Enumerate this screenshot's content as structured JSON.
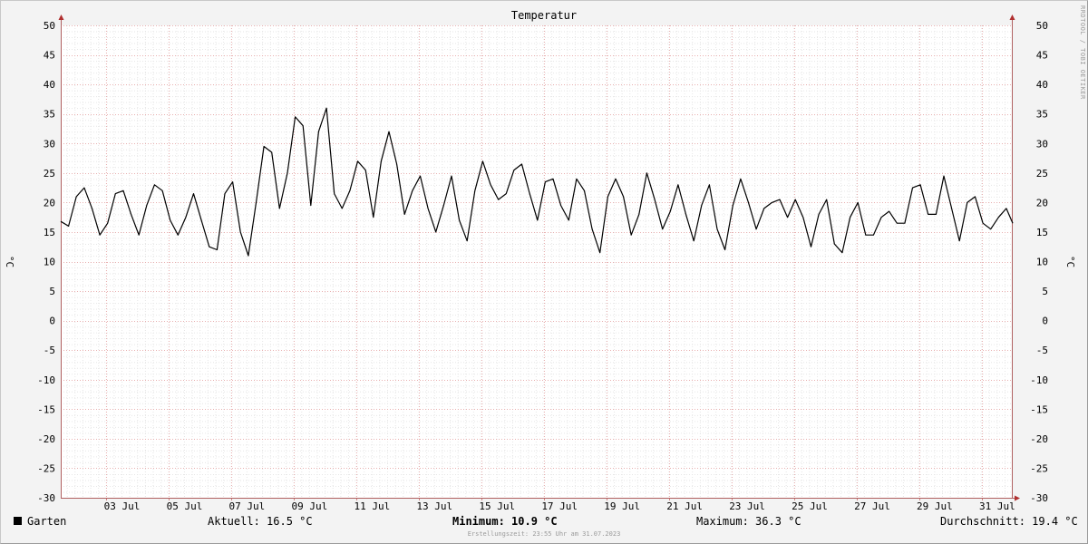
{
  "chart_data": {
    "type": "line",
    "title": "Temperatur",
    "ylabel": "°C",
    "ylim": [
      -30,
      50
    ],
    "xlim": [
      "2023-07-01 13:00",
      "2023-07-31 23:55"
    ],
    "y_ticks": [
      50,
      45,
      40,
      35,
      30,
      25,
      20,
      15,
      10,
      5,
      0,
      -5,
      -10,
      -15,
      -20,
      -25,
      -30
    ],
    "x_tick_labels": [
      "03 Jul",
      "05 Jul",
      "07 Jul",
      "09 Jul",
      "11 Jul",
      "13 Jul",
      "15 Jul",
      "17 Jul",
      "19 Jul",
      "21 Jul",
      "23 Jul",
      "25 Jul",
      "27 Jul",
      "29 Jul",
      "31 Jul"
    ],
    "grid": true,
    "line_color": "#000000",
    "series": [
      {
        "name": "Garten",
        "x": [
          "2023-07-01 13:00",
          "2023-07-01 19:00",
          "2023-07-02 01:00",
          "2023-07-02 07:00",
          "2023-07-02 13:00",
          "2023-07-02 19:00",
          "2023-07-03 01:00",
          "2023-07-03 07:00",
          "2023-07-03 13:00",
          "2023-07-03 19:00",
          "2023-07-04 01:00",
          "2023-07-04 07:00",
          "2023-07-04 13:00",
          "2023-07-04 19:00",
          "2023-07-05 01:00",
          "2023-07-05 07:00",
          "2023-07-05 13:00",
          "2023-07-05 19:00",
          "2023-07-06 01:00",
          "2023-07-06 07:00",
          "2023-07-06 13:00",
          "2023-07-06 19:00",
          "2023-07-07 01:00",
          "2023-07-07 07:00",
          "2023-07-07 13:00",
          "2023-07-07 19:00",
          "2023-07-08 01:00",
          "2023-07-08 07:00",
          "2023-07-08 13:00",
          "2023-07-08 19:00",
          "2023-07-09 01:00",
          "2023-07-09 07:00",
          "2023-07-09 13:00",
          "2023-07-09 19:00",
          "2023-07-10 01:00",
          "2023-07-10 07:00",
          "2023-07-10 13:00",
          "2023-07-10 19:00",
          "2023-07-11 01:00",
          "2023-07-11 07:00",
          "2023-07-11 13:00",
          "2023-07-11 19:00",
          "2023-07-12 01:00",
          "2023-07-12 07:00",
          "2023-07-12 13:00",
          "2023-07-12 19:00",
          "2023-07-13 01:00",
          "2023-07-13 07:00",
          "2023-07-13 13:00",
          "2023-07-13 19:00",
          "2023-07-14 01:00",
          "2023-07-14 07:00",
          "2023-07-14 13:00",
          "2023-07-14 19:00",
          "2023-07-15 01:00",
          "2023-07-15 07:00",
          "2023-07-15 13:00",
          "2023-07-15 19:00",
          "2023-07-16 01:00",
          "2023-07-16 07:00",
          "2023-07-16 13:00",
          "2023-07-16 19:00",
          "2023-07-17 01:00",
          "2023-07-17 07:00",
          "2023-07-17 13:00",
          "2023-07-17 19:00",
          "2023-07-18 01:00",
          "2023-07-18 07:00",
          "2023-07-18 13:00",
          "2023-07-18 19:00",
          "2023-07-19 01:00",
          "2023-07-19 07:00",
          "2023-07-19 13:00",
          "2023-07-19 19:00",
          "2023-07-20 01:00",
          "2023-07-20 07:00",
          "2023-07-20 13:00",
          "2023-07-20 19:00",
          "2023-07-21 01:00",
          "2023-07-21 07:00",
          "2023-07-21 13:00",
          "2023-07-21 19:00",
          "2023-07-22 01:00",
          "2023-07-22 07:00",
          "2023-07-22 13:00",
          "2023-07-22 19:00",
          "2023-07-23 01:00",
          "2023-07-23 07:00",
          "2023-07-23 13:00",
          "2023-07-23 19:00",
          "2023-07-24 01:00",
          "2023-07-24 07:00",
          "2023-07-24 13:00",
          "2023-07-24 19:00",
          "2023-07-25 01:00",
          "2023-07-25 07:00",
          "2023-07-25 13:00",
          "2023-07-25 19:00",
          "2023-07-26 01:00",
          "2023-07-26 07:00",
          "2023-07-26 13:00",
          "2023-07-26 19:00",
          "2023-07-27 01:00",
          "2023-07-27 07:00",
          "2023-07-27 13:00",
          "2023-07-27 19:00",
          "2023-07-28 01:00",
          "2023-07-28 07:00",
          "2023-07-28 13:00",
          "2023-07-28 19:00",
          "2023-07-29 01:00",
          "2023-07-29 07:00",
          "2023-07-29 13:00",
          "2023-07-29 19:00",
          "2023-07-30 01:00",
          "2023-07-30 07:00",
          "2023-07-30 13:00",
          "2023-07-30 19:00",
          "2023-07-31 01:00",
          "2023-07-31 07:00",
          "2023-07-31 13:00",
          "2023-07-31 19:00",
          "2023-07-31 23:55"
        ],
        "values": [
          16.8,
          16.0,
          21.0,
          22.5,
          19.0,
          14.5,
          16.5,
          21.5,
          22.0,
          18.0,
          14.5,
          19.5,
          23.0,
          22.0,
          17.0,
          14.5,
          17.5,
          21.5,
          17.0,
          12.5,
          12.0,
          21.5,
          23.5,
          15.0,
          11.0,
          20.0,
          29.5,
          28.5,
          19.0,
          25.0,
          34.5,
          33.0,
          19.5,
          32.0,
          36.0,
          21.5,
          19.0,
          22.0,
          27.0,
          25.5,
          17.5,
          27.0,
          32.0,
          26.5,
          18.0,
          22.0,
          24.5,
          19.0,
          15.0,
          19.5,
          24.5,
          17.0,
          13.5,
          22.0,
          27.0,
          23.0,
          20.5,
          21.5,
          25.5,
          26.5,
          21.5,
          17.0,
          23.5,
          24.0,
          19.5,
          17.0,
          24.0,
          22.0,
          15.5,
          11.5,
          21.0,
          24.0,
          21.0,
          14.5,
          18.0,
          25.0,
          20.5,
          15.5,
          18.5,
          23.0,
          18.0,
          13.5,
          19.5,
          23.0,
          15.5,
          12.0,
          19.5,
          24.0,
          20.0,
          15.5,
          19.0,
          20.0,
          20.5,
          17.5,
          20.5,
          17.5,
          12.5,
          18.0,
          20.5,
          13.0,
          11.5,
          17.5,
          20.0,
          14.5,
          14.5,
          17.5,
          18.5,
          16.5,
          16.5,
          22.5,
          23.0,
          18.0,
          18.0,
          24.5,
          19.0,
          13.5,
          20.0,
          21.0,
          16.5,
          15.5,
          17.5,
          19.0,
          16.5
        ]
      }
    ]
  },
  "legend": {
    "series_name": "Garten",
    "swatch_color": "#000000"
  },
  "stats": {
    "current_label": "Aktuell:",
    "current_value": "16.5 °C",
    "min_label": "Minimum:",
    "min_value": "10.9 °C",
    "max_label": "Maximum:",
    "max_value": "36.3 °C",
    "avg_label": "Durchschnitt:",
    "avg_value": "19.4 °C"
  },
  "footer": {
    "created": "Erstellungszeit: 23:55 Uhr am 31.07.2023"
  },
  "watermark": "RRDTOOL / TOBI OETIKER"
}
